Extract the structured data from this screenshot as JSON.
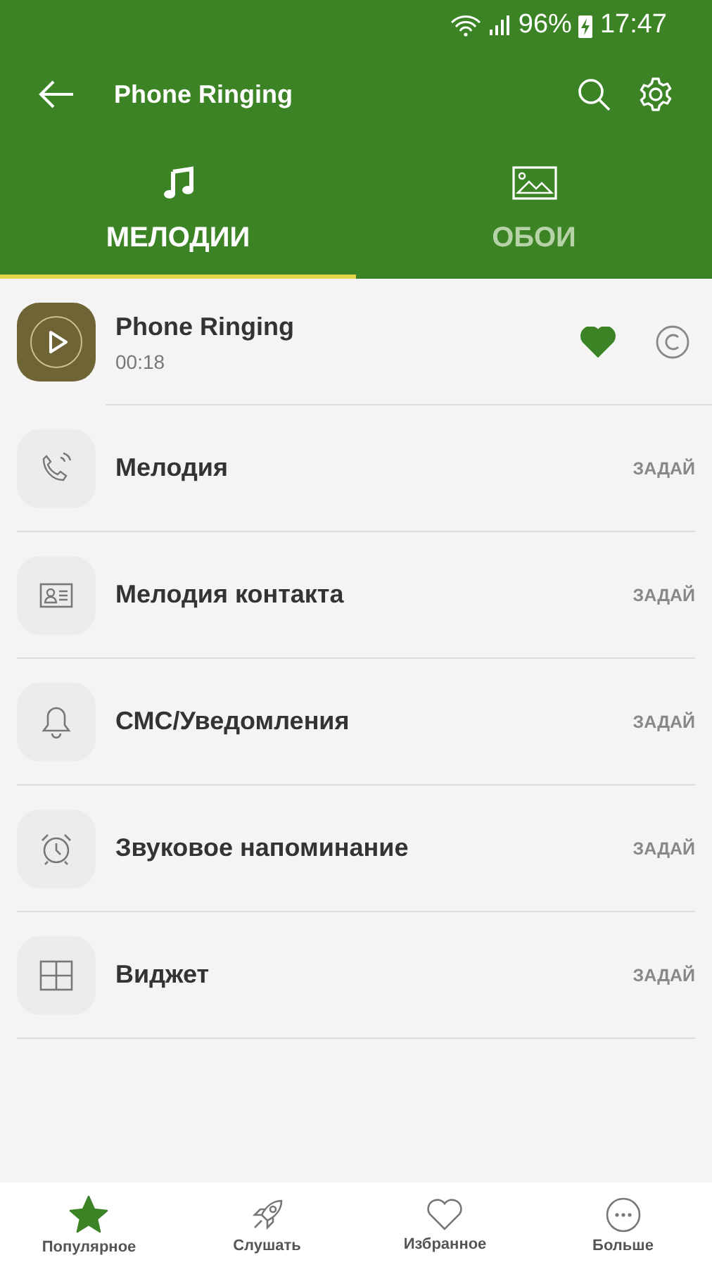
{
  "status_bar": {
    "battery": "96%",
    "time": "17:47"
  },
  "toolbar": {
    "title": "Phone Ringing"
  },
  "tabs": [
    {
      "label": "МЕЛОДИИ",
      "kind": "music",
      "selected": true
    },
    {
      "label": "ОБОИ",
      "kind": "image",
      "selected": false
    }
  ],
  "track": {
    "title": "Phone Ringing",
    "duration": "00:18",
    "favorite": true
  },
  "actions": [
    {
      "label": "Мелодия",
      "kind": "phone",
      "button": "ЗАДАЙ"
    },
    {
      "label": "Мелодия контакта",
      "kind": "contact",
      "button": "ЗАДАЙ"
    },
    {
      "label": "СМС/Уведомления",
      "kind": "bell",
      "button": "ЗАДАЙ"
    },
    {
      "label": "Звуковое напоминание",
      "kind": "alarm",
      "button": "ЗАДАЙ"
    },
    {
      "label": "Виджет",
      "kind": "widget",
      "button": "ЗАДАЙ"
    }
  ],
  "bottom_nav": [
    {
      "label": "Популярное",
      "kind": "star",
      "selected": true
    },
    {
      "label": "Слушать",
      "kind": "rocket",
      "selected": false
    },
    {
      "label": "Избранное",
      "kind": "heart",
      "selected": false
    },
    {
      "label": "Больше",
      "kind": "more",
      "selected": false
    }
  ]
}
